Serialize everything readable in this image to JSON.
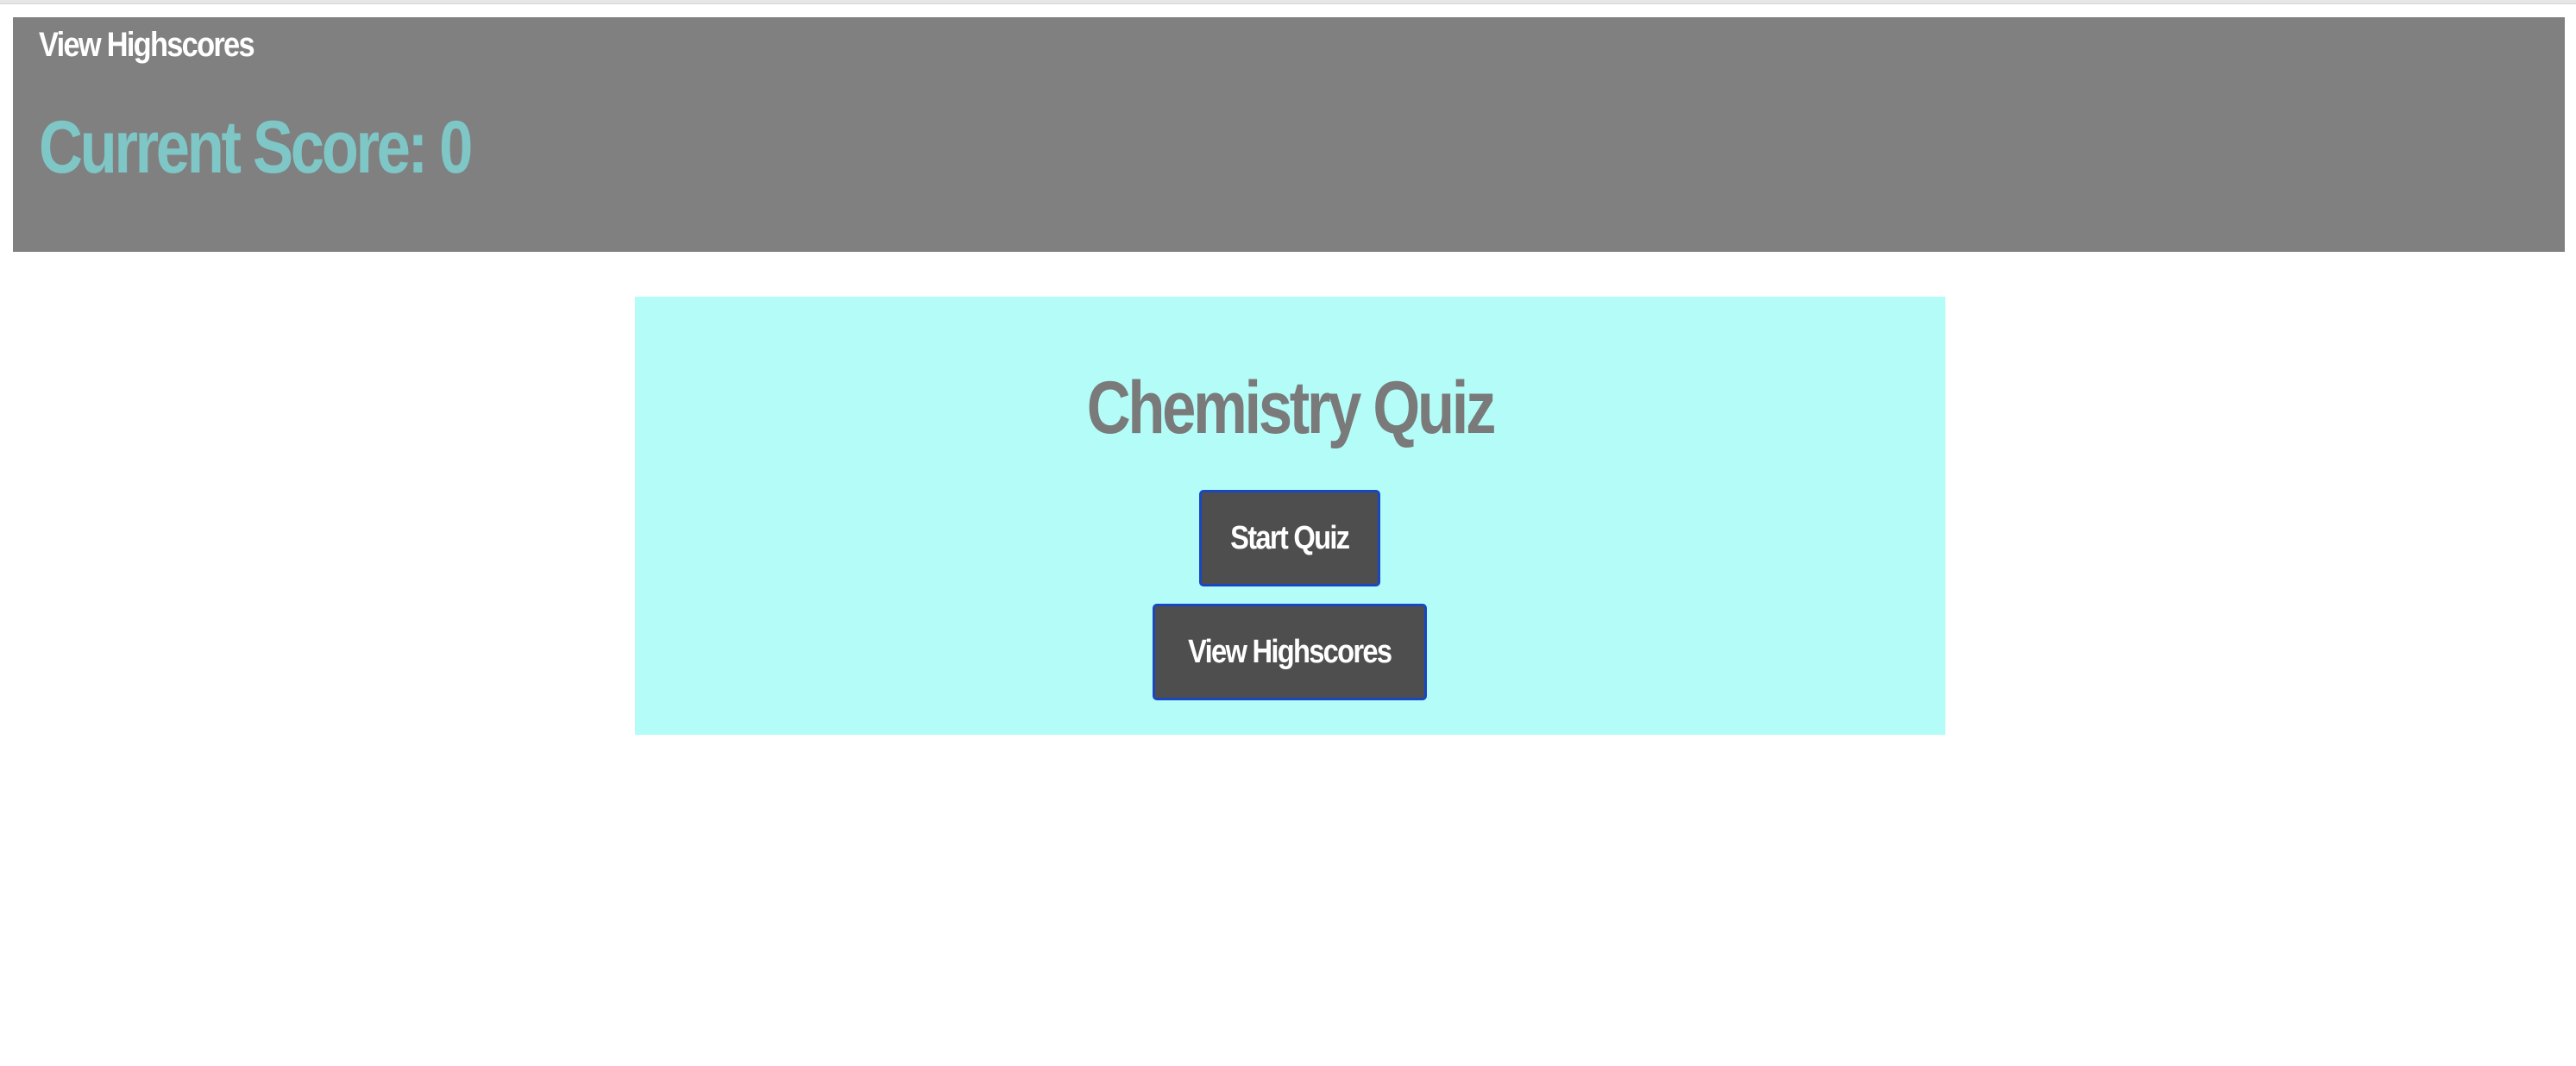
{
  "header": {
    "link_label": "View Highscores",
    "score_label": "Current Score: ",
    "score_value": "0"
  },
  "card": {
    "title": "Chemistry Quiz",
    "start_button_label": "Start Quiz",
    "highscores_button_label": "View Highscores"
  },
  "colors": {
    "header_bg": "#808080",
    "score_text": "#7fc6c6",
    "card_bg": "#b3fcf7",
    "title_text": "#7a7a7a",
    "button_bg": "#4e4e4e",
    "button_border": "#1a46c0"
  }
}
